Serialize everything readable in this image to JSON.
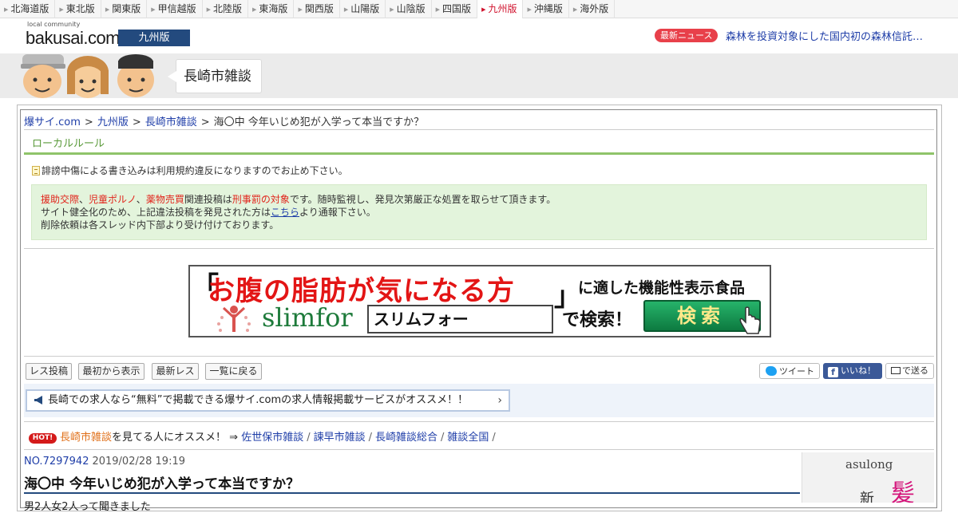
{
  "regions": [
    {
      "label": "北海道版",
      "active": false
    },
    {
      "label": "東北版",
      "active": false
    },
    {
      "label": "関東版",
      "active": false
    },
    {
      "label": "甲信越版",
      "active": false
    },
    {
      "label": "北陸版",
      "active": false
    },
    {
      "label": "東海版",
      "active": false
    },
    {
      "label": "関西版",
      "active": false
    },
    {
      "label": "山陽版",
      "active": false
    },
    {
      "label": "山陰版",
      "active": false
    },
    {
      "label": "四国版",
      "active": false
    },
    {
      "label": "九州版",
      "active": true
    },
    {
      "label": "沖縄版",
      "active": false
    },
    {
      "label": "海外版",
      "active": false
    }
  ],
  "header": {
    "logo_small": "local community",
    "logo_main": "bakusai.com",
    "edition": "九州版",
    "news_label": "最新ニュース",
    "news_headline": "森林を投資対象にした国内初の森林信託…"
  },
  "board": {
    "title": "長崎市雑談"
  },
  "breadcrumb": {
    "site": "爆サイ.com",
    "edition": "九州版",
    "board": "長崎市雑談",
    "current": "海〇中 今年いじめ犯が入学って本当ですか？",
    "sep": ">"
  },
  "rules": {
    "title": "ローカルルール",
    "notice": "誹謗中傷による書き込みは利用規約違反になりますのでお止め下さい。",
    "line1_red1": "援助交際",
    "line1_comma1": "、",
    "line1_red2": "児童ポルノ",
    "line1_comma2": "、",
    "line1_red3": "薬物売買",
    "line1_mid": "関連投稿は",
    "line1_red4": "刑事罰の対象",
    "line1_end": "です。随時監視し、発見次第厳正な処置を取らせて頂きます。",
    "line2_pre": "サイト健全化のため、上記違法投稿を発見された方は",
    "line2_link": "こちら",
    "line2_post": "より通報下さい。",
    "line3": "削除依頼は各スレッド内下部より受け付けております。"
  },
  "ad": {
    "open_bracket": "「",
    "headline": "お腹の脂肪が気になる方",
    "close_bracket": "」",
    "subline": "に適した機能性表示食品",
    "brand": "slimfor",
    "search_term": "スリムフォー",
    "search_text": "で検索！",
    "button": "検索"
  },
  "actions": {
    "post": "レス投稿",
    "from_start": "最初から表示",
    "latest": "最新レス",
    "back_list": "一覧に戻る",
    "tweet": "ツイート",
    "like": "いいね！",
    "send": "で送る"
  },
  "promo": {
    "text": "長崎での求人なら“無料”で掲載できる爆サイ.comの求人情報掲載サービスがオススメ！！"
  },
  "reco": {
    "badge": "HOT!",
    "board": "長崎市雑談",
    "text": "を見てる人にオススメ！ ⇒",
    "links": [
      "佐世保市雑談",
      "諫早市雑談",
      "長崎雑談総合",
      "雑談全国"
    ],
    "slash": "/"
  },
  "post": {
    "number": "NO.7297942",
    "date": "2019/02/28 19:19",
    "title": "海〇中 今年いじめ犯が入学って本当ですか？",
    "body_partial": "男2人女2人って聞きました"
  },
  "side_ad": {
    "brand": "asulong",
    "char1": "新",
    "char2": "髪"
  },
  "colors": {
    "accent_red": "#d0102b",
    "navy": "#234a7e",
    "link": "#1f3ea8",
    "green": "#8fc46a"
  }
}
